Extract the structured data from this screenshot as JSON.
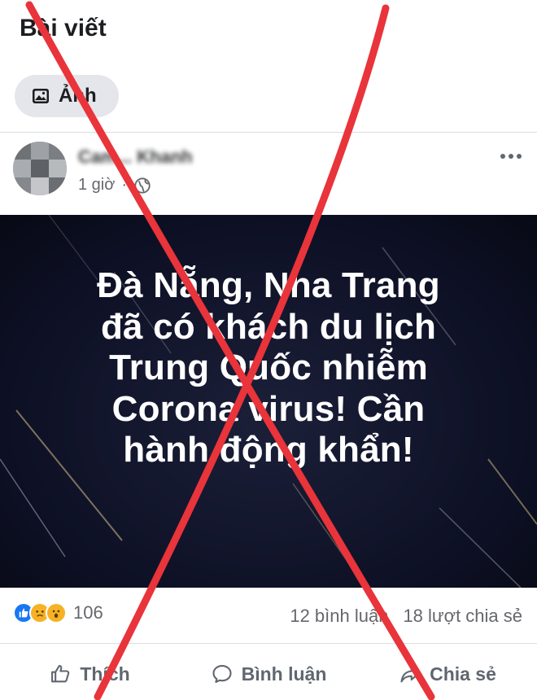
{
  "header": {
    "title": "Bài viết"
  },
  "filter_chip": {
    "icon": "photo-icon",
    "label": "Ảnh"
  },
  "post": {
    "author_name": "Cam... Khanh",
    "time": "1 giờ",
    "privacy_icon": "globe-icon",
    "more_icon": "more-options-icon",
    "image_text": {
      "lines": [
        "Đà Nẵng, Nha Trang",
        "đã có khách du lịch",
        "Trung Quốc nhiễm",
        "Corona virus! Cần",
        "hành động khẩn!"
      ]
    },
    "reactions": {
      "icons": [
        "like-icon",
        "sad-icon",
        "wow-icon"
      ],
      "count": "106"
    },
    "comments_count": "12 bình luận",
    "shares_count": "18 lượt chia sẻ",
    "actions": {
      "like": "Thích",
      "comment": "Bình luận",
      "share": "Chia sẻ"
    }
  },
  "overlay": {
    "mark": "red-x-cross",
    "color": "#e8343a"
  }
}
